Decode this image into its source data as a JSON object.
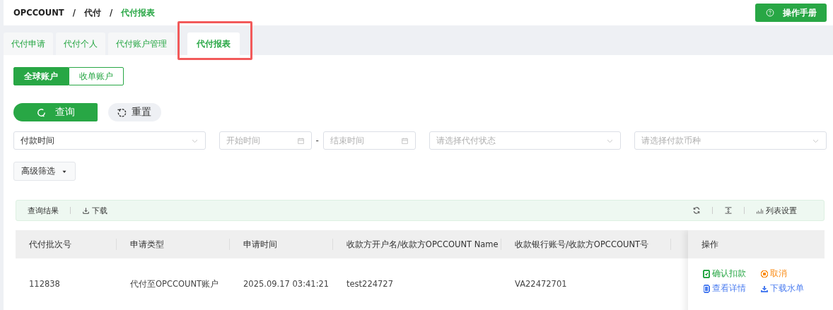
{
  "breadcrumb": [
    {
      "label": "OPCCOUNT",
      "selected": false
    },
    {
      "label": "代付",
      "selected": false
    },
    {
      "label": "代付报表",
      "selected": true
    }
  ],
  "breadcrumb_separator": "/",
  "manual_button": "操作手册",
  "tabs": [
    {
      "label": "代付申请",
      "selected": false,
      "highlighted": false
    },
    {
      "label": "代付个人",
      "selected": false,
      "highlighted": false
    },
    {
      "label": "代付账户管理",
      "selected": false,
      "highlighted": false
    },
    {
      "label": "代付报表",
      "selected": true,
      "highlighted": true
    }
  ],
  "account_switch": [
    {
      "label": "全球账户",
      "selected": true
    },
    {
      "label": "收单账户",
      "selected": false
    }
  ],
  "actions": {
    "search": "查询",
    "reset": "重置"
  },
  "filters": {
    "date_type": {
      "value": "付款时间"
    },
    "start_date": {
      "placeholder": "开始时间"
    },
    "range_separator": "-",
    "end_date": {
      "placeholder": "结束时间"
    },
    "status": {
      "placeholder": "请选择代付状态"
    },
    "currency": {
      "placeholder": "请选择付款币种"
    }
  },
  "advanced_filter": "高级筛选",
  "result_toolbar": {
    "title": "查询结果",
    "download": "下载",
    "column_settings": "列表设置"
  },
  "table": {
    "columns": [
      "代付批次号",
      "申请类型",
      "申请时间",
      "收款方开户名/收款方OPCCOUNT Name",
      "收款银行账号/收款方OPCCOUNT号"
    ],
    "action_column": "操作",
    "rows": [
      {
        "cells": [
          "112838",
          "代付至OPCCOUNT账户",
          "2025.09.17 03:41:21",
          "test224727",
          "VA22472701"
        ],
        "actions": [
          {
            "kind": "confirm",
            "label": "确认扣款",
            "color": "#28a745"
          },
          {
            "kind": "cancel",
            "label": "取消",
            "color": "#fa8c16"
          },
          {
            "kind": "view",
            "label": "查看详情",
            "color": "#4a7cf0"
          },
          {
            "kind": "download",
            "label": "下载水单",
            "color": "#4a7cf0"
          }
        ]
      }
    ]
  }
}
